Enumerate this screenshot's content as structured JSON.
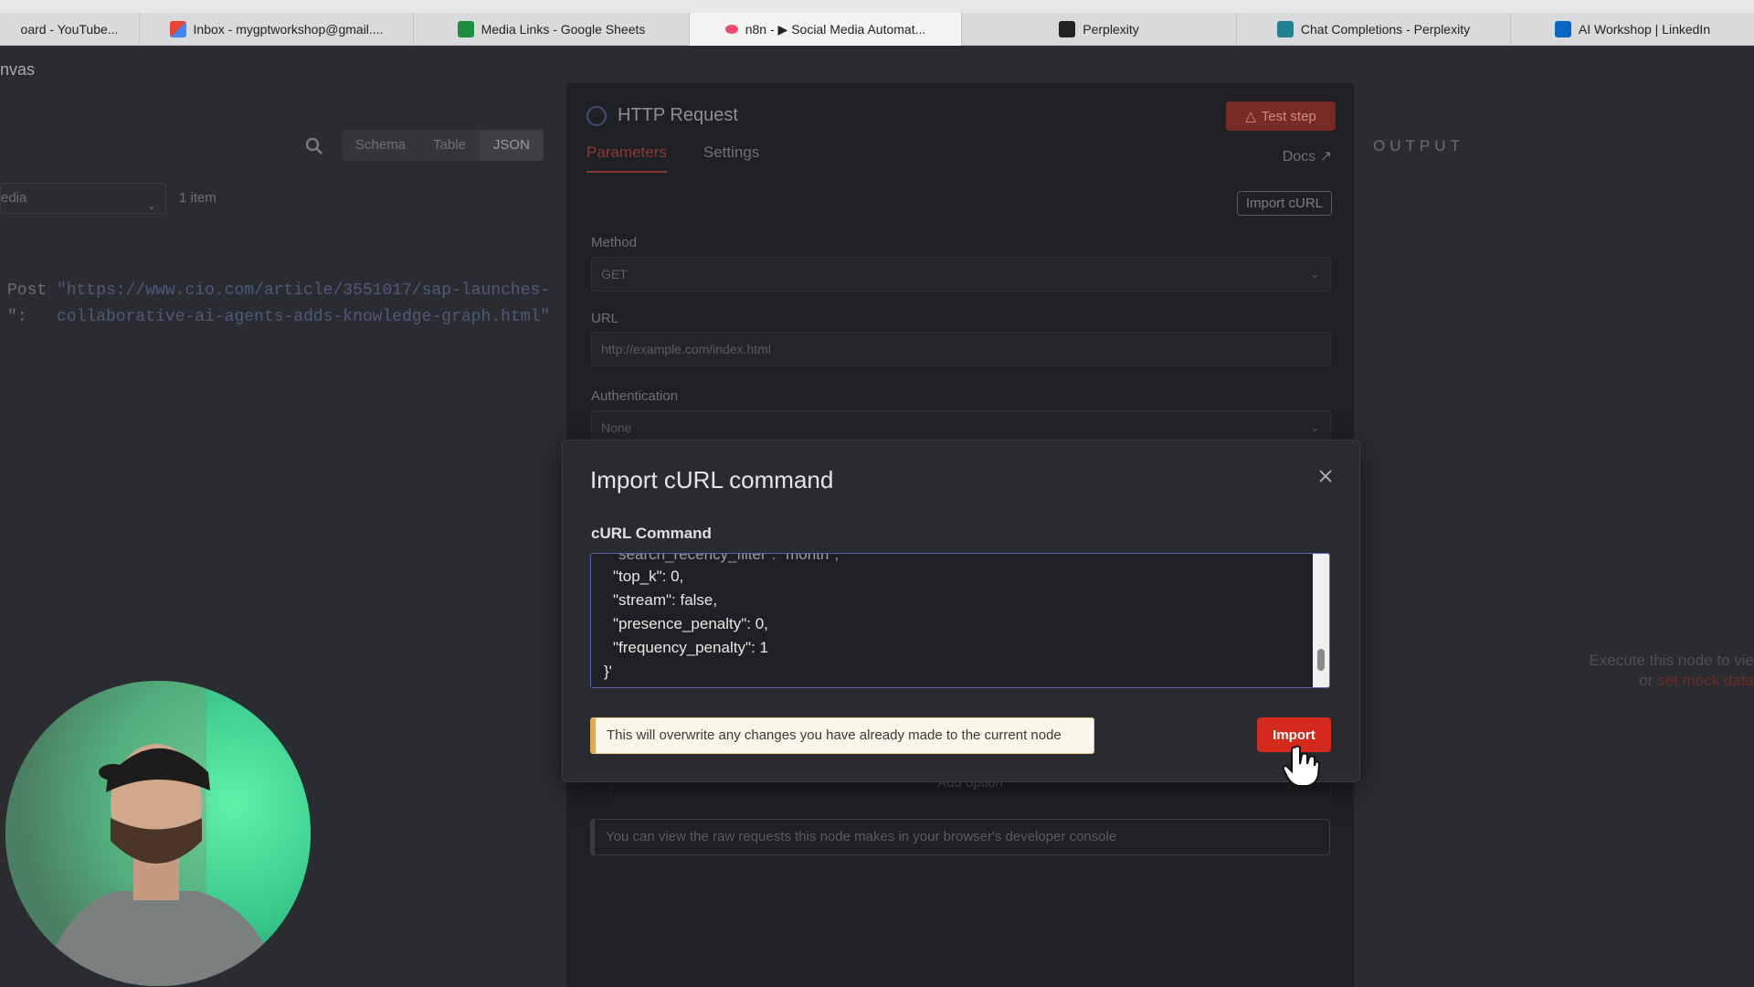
{
  "browser": {
    "tabs": [
      {
        "label": "oard - YouTube...",
        "icon": "youtube-icon",
        "color": "#d9dadc"
      },
      {
        "label": "Inbox - mygptworkshop@gmail....",
        "icon": "gmail-icon",
        "color": "#ea4335"
      },
      {
        "label": "Media Links - Google Sheets",
        "icon": "sheets-icon",
        "color": "#1e8e3e"
      },
      {
        "label": "n8n - ▶ Social Media Automat...",
        "icon": "n8n-icon",
        "color": "#ea4b71"
      },
      {
        "label": "Perplexity",
        "icon": "perplexity-icon",
        "color": "#222222"
      },
      {
        "label": "Chat Completions - Perplexity",
        "icon": "perplexity-docs-icon",
        "color": "#20808d"
      },
      {
        "label": "AI Workshop | LinkedIn",
        "icon": "linkedin-icon",
        "color": "#0a66c2"
      }
    ]
  },
  "left_panel": {
    "canvas_label": "nvas",
    "view_tabs": [
      "Schema",
      "Table",
      "JSON"
    ],
    "node_select": "edia",
    "items_count": "1 item",
    "json_line1_key": "Post ",
    "json_line1_value": "\"https://www.cio.com/article/3551017/sap-launches-",
    "json_line2_key": "\":  ",
    "json_line2_value": " collaborative-ai-agents-adds-knowledge-graph.html\""
  },
  "node": {
    "title": "HTTP Request",
    "test_step": "Test step",
    "tabs": [
      "Parameters",
      "Settings"
    ],
    "docs": "Docs",
    "import_curl": "Import cURL",
    "method_label": "Method",
    "method_value": "GET",
    "url_label": "URL",
    "url_placeholder": "http://example.com/index.html",
    "auth_label": "Authentication",
    "auth_value": "None",
    "add_option": "Add option",
    "console_note": "You can view the raw requests this node makes in your browser's developer console"
  },
  "output": {
    "label": "OUTPUT",
    "hint_line1": "Execute this node to vie",
    "hint_line2_prefix": "or ",
    "hint_line2_link": "set mock data"
  },
  "modal": {
    "title": "Import cURL command",
    "field_label": "cURL Command",
    "code_lines": [
      "\"search_recency_filter\": \"month\",",
      "\"top_k\": 0,",
      "\"stream\": false,",
      "\"presence_penalty\": 0,",
      "\"frequency_penalty\": 1",
      "}'"
    ],
    "warning": "This will overwrite any changes you have already made to the current node",
    "import_button": "Import"
  }
}
